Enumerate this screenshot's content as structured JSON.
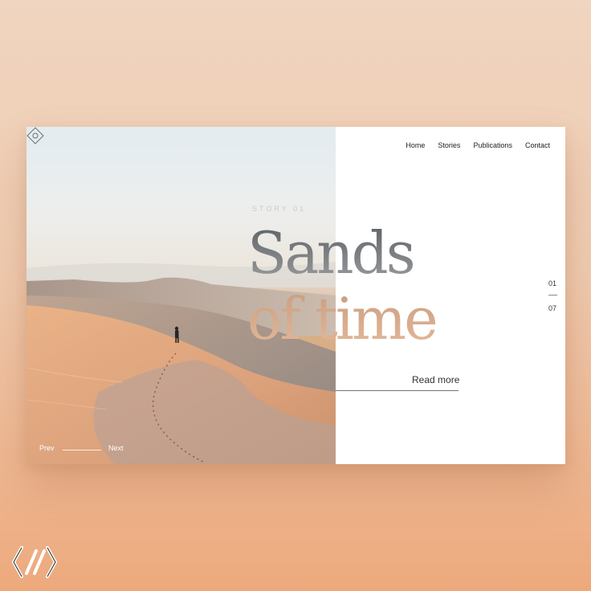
{
  "nav": {
    "items": [
      "Home",
      "Stories",
      "Publications",
      "Contact"
    ]
  },
  "hero": {
    "eyebrow": "STORY 01",
    "title_line1": "Sands",
    "title_line2": "of time",
    "cta": "Read more"
  },
  "pager": {
    "current": "01",
    "total": "07"
  },
  "slider": {
    "prev": "Prev",
    "next": "Next"
  },
  "icons": {
    "site_logo": "diamond-logo-icon",
    "brand_mark": "brand-logo-icon"
  },
  "colors": {
    "background_top": "#f0d5c0",
    "background_bottom": "#eda97c",
    "card": "#ffffff",
    "text": "#222222"
  }
}
